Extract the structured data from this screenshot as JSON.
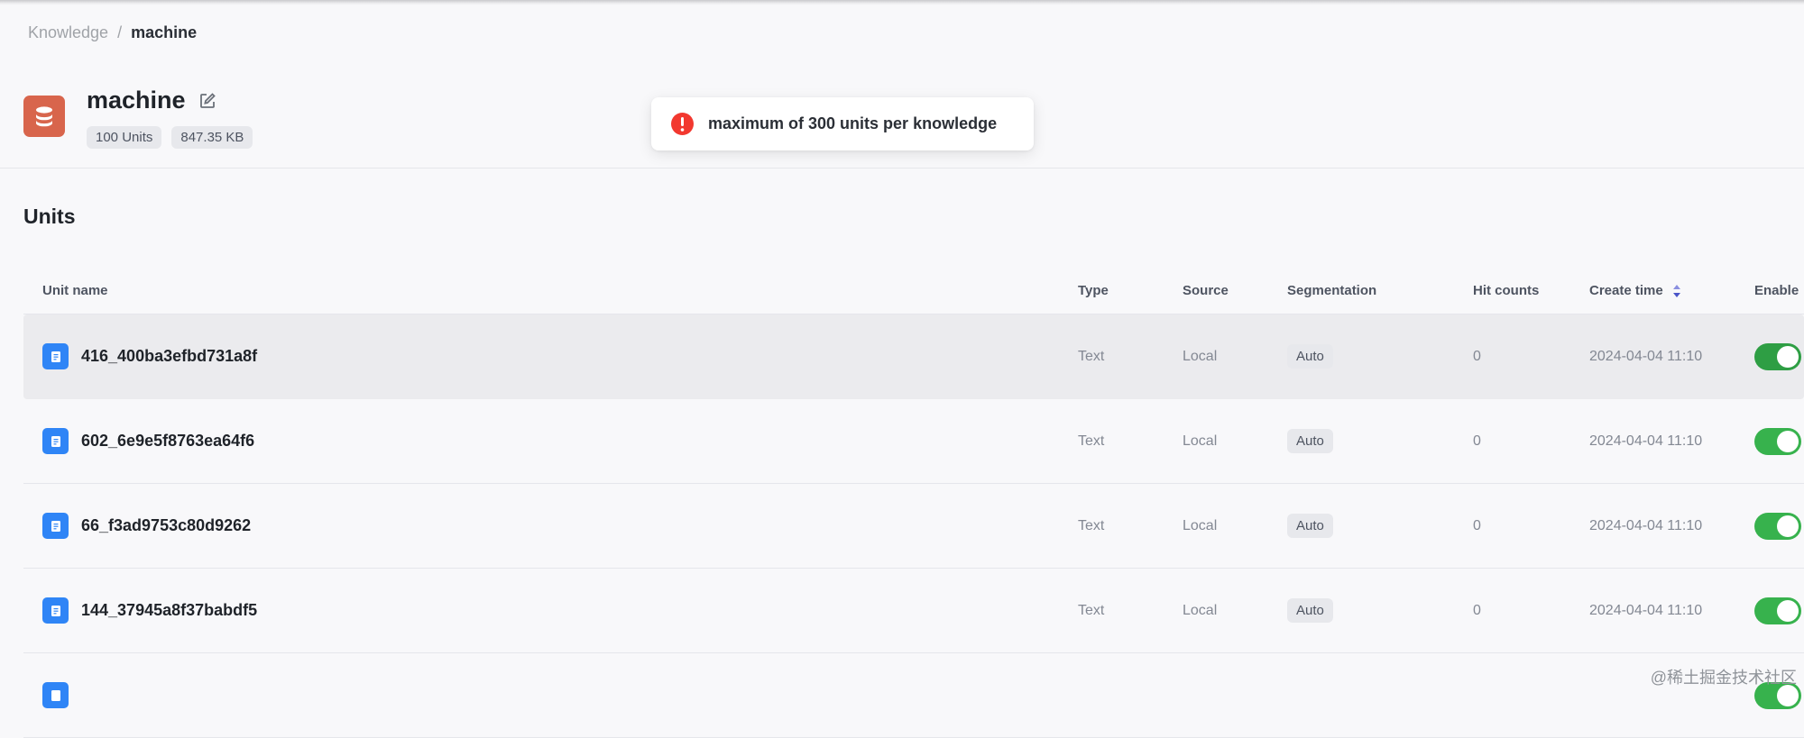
{
  "breadcrumb": {
    "root": "Knowledge",
    "separator": "/",
    "current": "machine"
  },
  "knowledge": {
    "title": "machine",
    "units_tag": "100 Units",
    "size_tag": "847.35 KB"
  },
  "toast": {
    "message": "maximum of 300 units per knowledge",
    "type": "error"
  },
  "section_title": "Units",
  "table": {
    "columns": {
      "name": "Unit name",
      "type": "Type",
      "source": "Source",
      "segmentation": "Segmentation",
      "hits": "Hit counts",
      "created": "Create time",
      "enable": "Enable"
    },
    "rows": [
      {
        "name": "416_400ba3efbd731a8f",
        "type": "Text",
        "source": "Local",
        "segmentation": "Auto",
        "hits": "0",
        "created": "2024-04-04 11:10",
        "enabled": true
      },
      {
        "name": "602_6e9e5f8763ea64f6",
        "type": "Text",
        "source": "Local",
        "segmentation": "Auto",
        "hits": "0",
        "created": "2024-04-04 11:10",
        "enabled": true
      },
      {
        "name": "66_f3ad9753c80d9262",
        "type": "Text",
        "source": "Local",
        "segmentation": "Auto",
        "hits": "0",
        "created": "2024-04-04 11:10",
        "enabled": true
      },
      {
        "name": "144_37945a8f37babdf5",
        "type": "Text",
        "source": "Local",
        "segmentation": "Auto",
        "hits": "0",
        "created": "2024-04-04 11:10",
        "enabled": true
      }
    ]
  },
  "watermark": "@稀土掘金技术社区",
  "colors": {
    "accent_blue": "#2f85f6",
    "toggle_on": "#37b24d",
    "error_red": "#f2382f",
    "kb_icon": "#d8654c"
  }
}
